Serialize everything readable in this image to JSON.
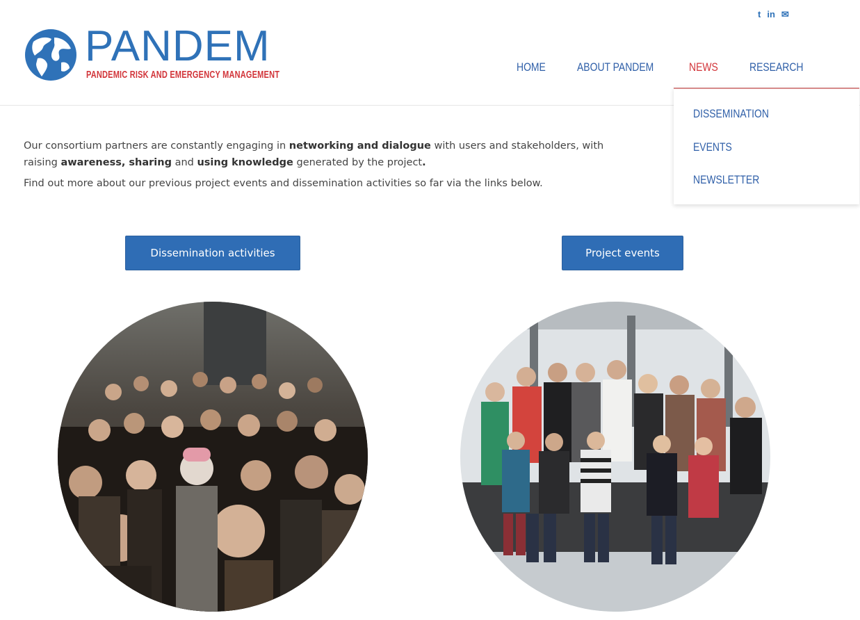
{
  "header": {
    "logo": {
      "wordmark": "PANDEM",
      "tagline": "PANDEMIC RISK AND EMERGENCY MANAGEMENT"
    },
    "social": [
      {
        "name": "twitter",
        "glyph": "t"
      },
      {
        "name": "linkedin",
        "glyph": "in"
      },
      {
        "name": "email",
        "glyph": "✉"
      }
    ],
    "nav": [
      {
        "label": "HOME",
        "active": false
      },
      {
        "label": "ABOUT PANDEM",
        "active": false
      },
      {
        "label": "NEWS",
        "active": true
      },
      {
        "label": "RESEARCH",
        "active": false
      }
    ],
    "dropdown": {
      "items": [
        "DISSEMINATION",
        "EVENTS",
        "NEWSLETTER"
      ]
    }
  },
  "main": {
    "intro": {
      "p1": [
        "Our consortium partners are constantly engaging in ",
        "networking and dialogue",
        " with users and stakeholders, with ",
        "raising ",
        "awareness, sharing",
        " and ",
        "using knowledge",
        " generated by the project",
        "."
      ],
      "p2": "Find out more about our previous project events and dissemination activities so far via the links below."
    },
    "buttons": {
      "dissemination": "Dissemination activities",
      "events": "Project events"
    }
  },
  "colors": {
    "brand_blue": "#2f72b8",
    "nav_blue": "#2f5fa8",
    "accent_red": "#d2353a",
    "button_blue": "#2f6db5"
  }
}
